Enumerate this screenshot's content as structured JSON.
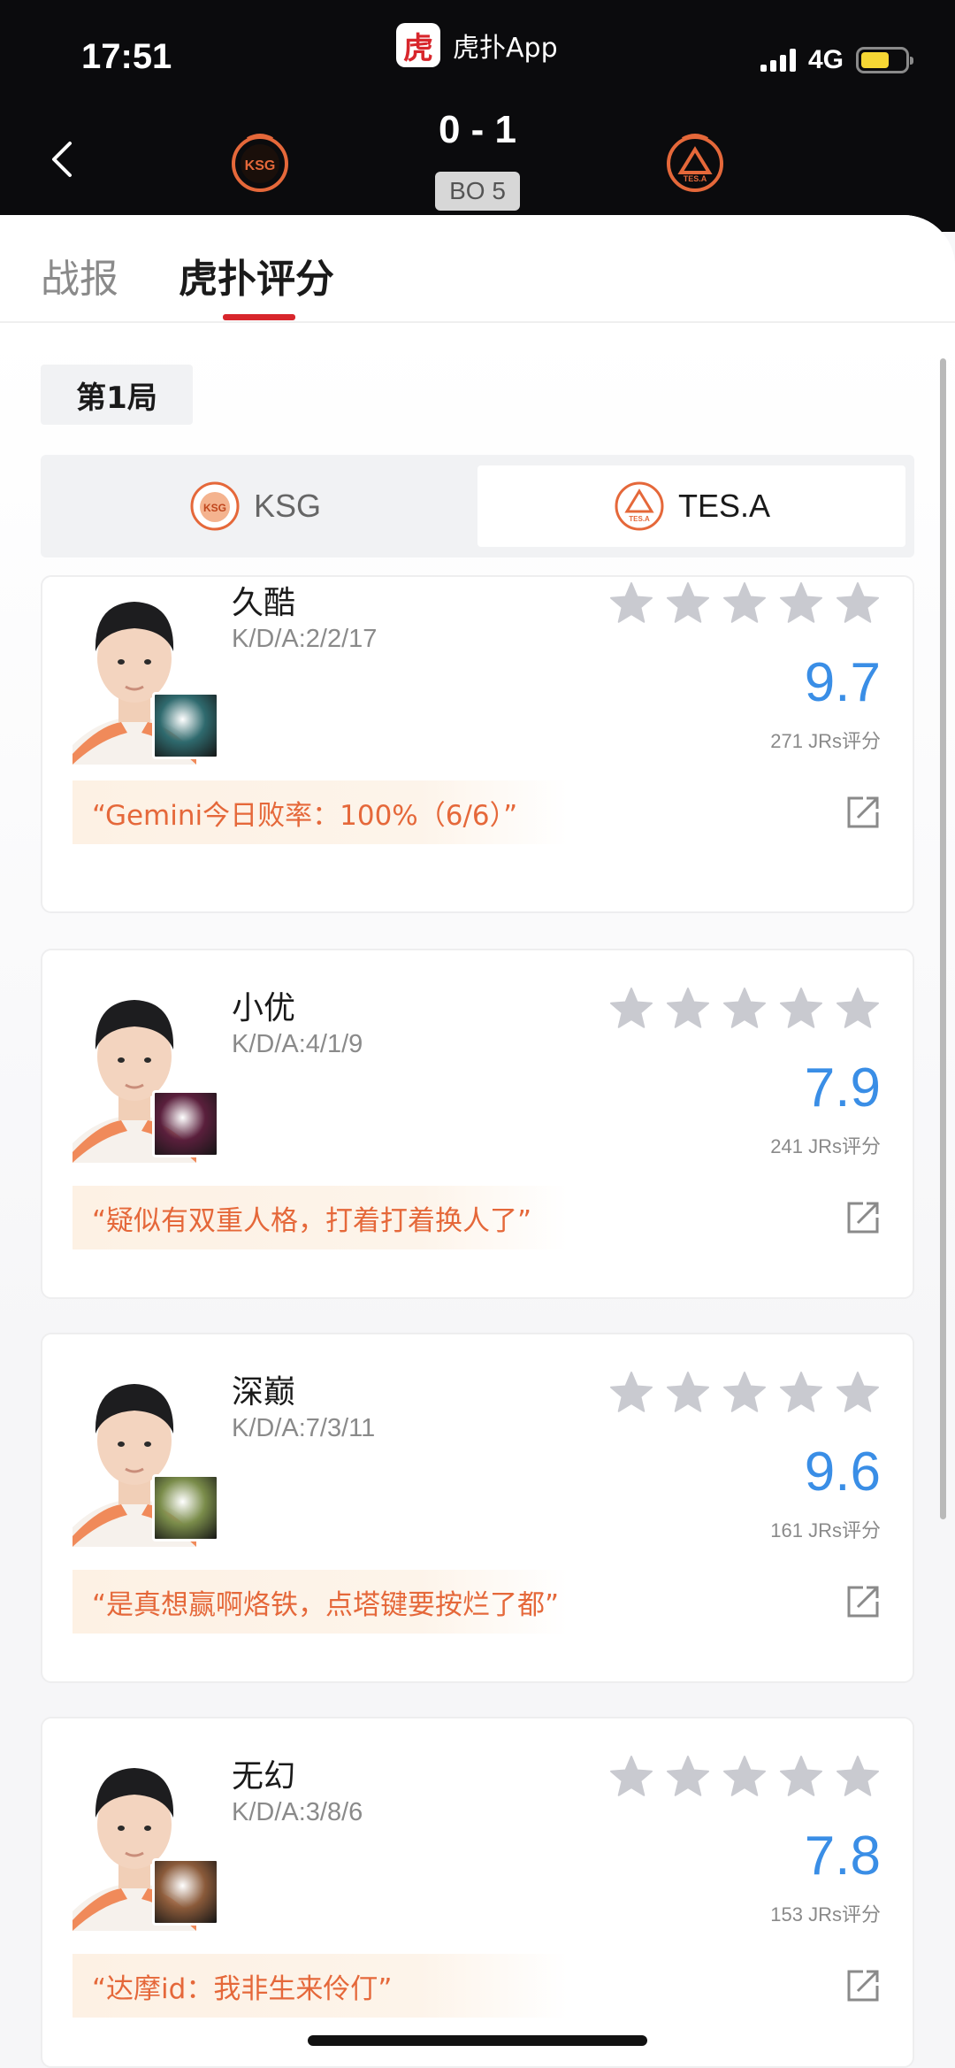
{
  "status_bar": {
    "time": "17:51",
    "app_name": "虎扑App",
    "app_logo_glyph": "虎",
    "network": "4G",
    "battery_color": "#f5d634"
  },
  "match": {
    "score": "0 - 1",
    "format": "BO 5",
    "home_logo_text": "KSG",
    "away_logo_text": "TES.A",
    "accent_color": "#e5683a"
  },
  "tabs": [
    {
      "label": "战报",
      "active": false
    },
    {
      "label": "虎扑评分",
      "active": true
    }
  ],
  "round_label": "第1局",
  "team_switch": [
    {
      "label": "KSG",
      "logo_text": "KSG",
      "selected": false
    },
    {
      "label": "TES.A",
      "logo_text": "TES.A",
      "selected": true
    }
  ],
  "players": [
    {
      "name": "久酷",
      "kda": "K/D/A:2/2/17",
      "rating": "9.7",
      "votes": "271 JRs评分",
      "quote": "“Gemini今日败率：100%（6/6）”",
      "hero_color": "#2f6a6e"
    },
    {
      "name": "小优",
      "kda": "K/D/A:4/1/9",
      "rating": "7.9",
      "votes": "241 JRs评分",
      "quote": "“疑似有双重人格，打着打着换人了”",
      "hero_color": "#5a1f3c"
    },
    {
      "name": "深巅",
      "kda": "K/D/A:7/3/11",
      "rating": "9.6",
      "votes": "161 JRs评分",
      "quote": "“是真想赢啊烙铁，点塔键要按烂了都”",
      "hero_color": "#7a8c4a"
    },
    {
      "name": "无幻",
      "kda": "K/D/A:3/8/6",
      "rating": "7.8",
      "votes": "153 JRs评分",
      "quote": "“达摩id：我非生来伶仃”",
      "hero_color": "#8a5a3a"
    }
  ],
  "icons": {
    "back": "back-chevron-icon",
    "star": "star-icon",
    "share": "share-icon"
  }
}
